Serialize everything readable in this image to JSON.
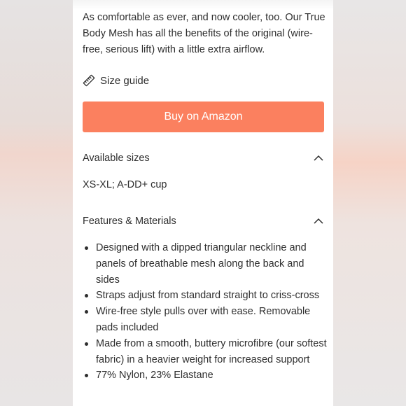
{
  "product": {
    "description": "As comfortable as ever, and now cooler, too. Our True Body Mesh has all the benefits of the original (wire-free, serious lift) with a little extra airflow.",
    "size_guide_label": "Size guide",
    "size_guide_icon": "ruler-icon",
    "buy_button_label": "Buy on Amazon",
    "buy_button_color": "#fb805f"
  },
  "available_sizes": {
    "title": "Available sizes",
    "expanded": true,
    "value": "XS-XL; A-DD+ cup"
  },
  "features": {
    "title": "Features & Materials",
    "expanded": true,
    "items": [
      "Designed with a dipped triangular neckline and panels of breathable mesh along the back and sides",
      "Straps adjust from standard straight to criss-cross",
      "Wire-free style pulls over with ease. Removable pads included",
      "Made from a smooth, buttery microfibre (our softest fabric) in a heavier weight for increased support",
      "77% Nylon, 23% Elastane"
    ]
  }
}
